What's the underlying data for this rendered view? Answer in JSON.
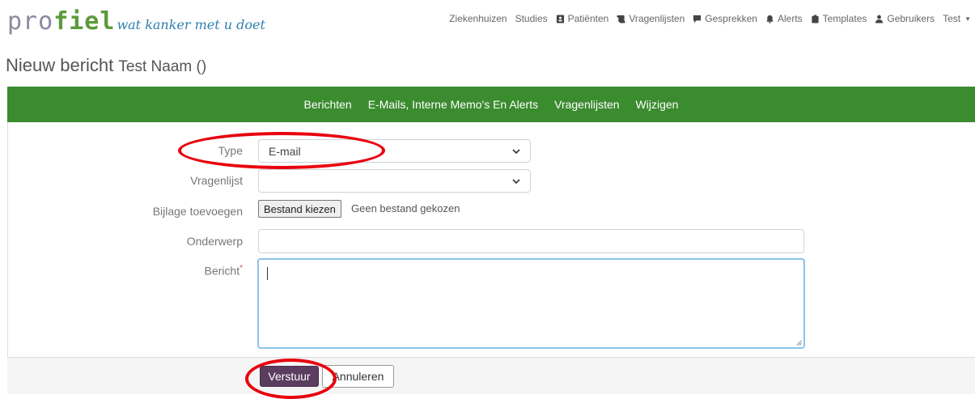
{
  "brand": {
    "logo_main_1": "pro",
    "logo_main_2": "fiel",
    "tagline": "wat kanker met u doet"
  },
  "nav": {
    "items": [
      {
        "label": "Ziekenhuizen",
        "icon": "none"
      },
      {
        "label": "Studies",
        "icon": "none"
      },
      {
        "label": "Patiënten",
        "icon": "id-card-icon"
      },
      {
        "label": "Vragenlijsten",
        "icon": "scroll-icon"
      },
      {
        "label": "Gesprekken",
        "icon": "comment-icon"
      },
      {
        "label": "Alerts",
        "icon": "bell-icon"
      },
      {
        "label": "Templates",
        "icon": "clipboard-icon"
      },
      {
        "label": "Gebruikers",
        "icon": "user-icon"
      },
      {
        "label": "Test",
        "icon": "caret-down"
      }
    ]
  },
  "page": {
    "title": "Nieuw bericht",
    "subtitle": "Test Naam ()"
  },
  "tabs": [
    {
      "label": "Berichten"
    },
    {
      "label": "E-Mails, Interne Memo's En Alerts"
    },
    {
      "label": "Vragenlijsten"
    },
    {
      "label": "Wijzigen"
    }
  ],
  "form": {
    "type_label": "Type",
    "type_value": "E-mail",
    "questionnaire_label": "Vragenlijst",
    "questionnaire_value": "",
    "attachment_label": "Bijlage toevoegen",
    "file_button": "Bestand kiezen",
    "file_status": "Geen bestand gekozen",
    "subject_label": "Onderwerp",
    "subject_value": "",
    "message_label": "Bericht",
    "required_mark": "*",
    "message_value": ""
  },
  "actions": {
    "send": "Verstuur",
    "cancel": "Annuleren"
  },
  "colors": {
    "accent_green": "#3b8b2f",
    "send_purple": "#5b3d5f",
    "annotation_red": "#e8000d"
  }
}
